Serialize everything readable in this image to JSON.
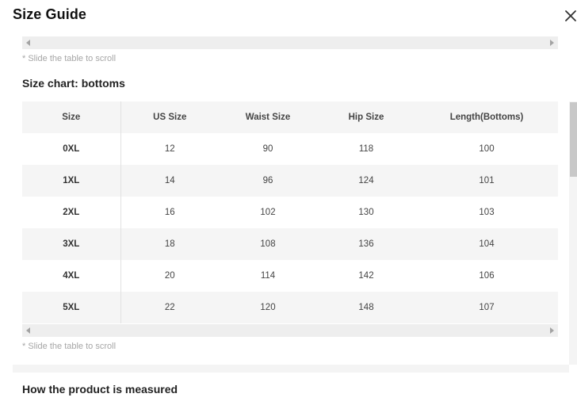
{
  "dialog": {
    "title": "Size Guide",
    "close_icon": "close-icon"
  },
  "hints": {
    "top": "* Slide the table to scroll",
    "bottom": "* Slide the table to scroll"
  },
  "size_chart": {
    "title": "Size chart: bottoms",
    "headers": [
      "Size",
      "US Size",
      "Waist Size",
      "Hip Size",
      "Length(Bottoms)"
    ],
    "rows": [
      [
        "0XL",
        "12",
        "90",
        "118",
        "100"
      ],
      [
        "1XL",
        "14",
        "96",
        "124",
        "101"
      ],
      [
        "2XL",
        "16",
        "102",
        "130",
        "103"
      ],
      [
        "3XL",
        "18",
        "108",
        "136",
        "104"
      ],
      [
        "4XL",
        "20",
        "114",
        "142",
        "106"
      ],
      [
        "5XL",
        "22",
        "120",
        "148",
        "107"
      ]
    ]
  },
  "measured": {
    "title": "How the product is measured"
  }
}
